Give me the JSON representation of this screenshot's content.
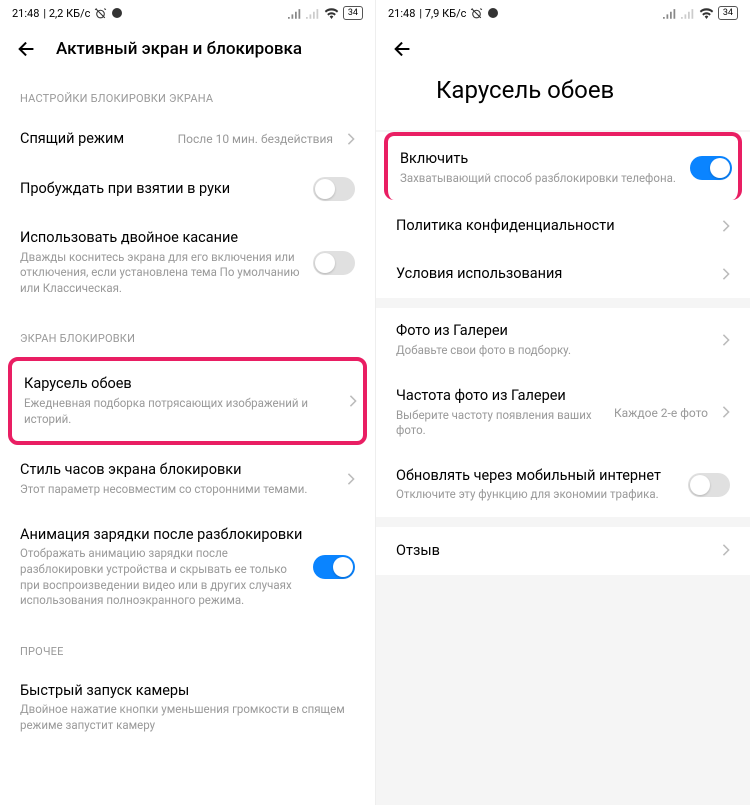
{
  "left": {
    "status": {
      "time": "21:48",
      "speed": "2,2 КБ/с",
      "battery": "34"
    },
    "title": "Активный экран и блокировка",
    "sec1": "НАСТРОЙКИ БЛОКИРОВКИ ЭКРАНА",
    "sleep": {
      "label": "Спящий режим",
      "value": "После 10 мин. бездействия"
    },
    "wake": {
      "label": "Пробуждать при взятии в руки"
    },
    "dbl": {
      "label": "Использовать двойное касание",
      "sub": "Дважды коснитесь экрана для его включения или отключения, если установлена тема По умолчанию или Классическая."
    },
    "sec2": "ЭКРАН БЛОКИРОВКИ",
    "carousel": {
      "label": "Карусель обоев",
      "sub": "Ежедневная подборка потрясающих изображений и историй."
    },
    "clock": {
      "label": "Стиль часов экрана блокировки",
      "sub": "Этот параметр несовместим со сторонними темами."
    },
    "anim": {
      "label": "Анимация зарядки после разблокировки",
      "sub": "Отображать анимацию зарядки после разблокировки устройства и скрывать ее только при воспроизведении видео или в других случаях использования полноэкранного режима."
    },
    "sec3": "ПРОЧЕЕ",
    "cam": {
      "label": "Быстрый запуск камеры",
      "sub": "Двойное нажатие кнопки уменьшения громкости в спящем режиме запустит камеру"
    }
  },
  "right": {
    "status": {
      "time": "21:48",
      "speed": "7,9 КБ/с",
      "battery": "34"
    },
    "title": "Карусель обоев",
    "enable": {
      "label": "Включить",
      "sub": "Захватывающий способ разблокировки телефона."
    },
    "privacy": "Политика конфиденциальности",
    "terms": "Условия использования",
    "gallery": {
      "label": "Фото из Галереи",
      "sub": "Добавьте свои фото в подборку."
    },
    "freq": {
      "label": "Частота фото из Галереи",
      "sub": "Выберите частоту появления ваших фото.",
      "value": "Каждое 2-е фото"
    },
    "mobile": {
      "label": "Обновлять через мобильный интернет",
      "sub": "Отключите эту функцию для экономии трафика."
    },
    "review": "Отзыв"
  }
}
